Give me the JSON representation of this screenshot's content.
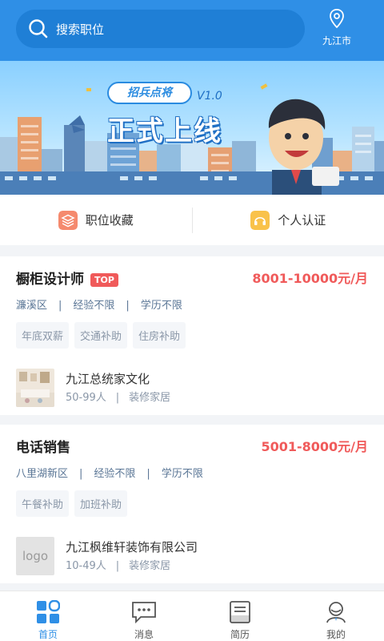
{
  "header": {
    "search_placeholder": "搜索职位",
    "city": "九江市"
  },
  "banner": {
    "badge": "招兵点将",
    "version": "V1.0",
    "headline": "正式上线"
  },
  "quick_links": [
    {
      "label": "职位收藏",
      "icon": "stack-icon",
      "color": "#f58a6e"
    },
    {
      "label": "个人认证",
      "icon": "headset-icon",
      "color": "#f9c24a"
    }
  ],
  "jobs": [
    {
      "title": "橱柜设计师",
      "badge": "TOP",
      "salary": "8001-10000元/月",
      "district": "濂溪区",
      "experience": "经验不限",
      "education": "学历不限",
      "tags": [
        "年底双薪",
        "交通补助",
        "住房补助"
      ],
      "company": "九江总统家文化",
      "size": "50-99人",
      "industry": "装修家居",
      "logo_text": ""
    },
    {
      "title": "电话销售",
      "badge": "",
      "salary": "5001-8000元/月",
      "district": "八里湖新区",
      "experience": "经验不限",
      "education": "学历不限",
      "tags": [
        "午餐补助",
        "加班补助"
      ],
      "company": "九江枫维轩装饰有限公司",
      "size": "10-49人",
      "industry": "装修家居",
      "logo_text": "logo"
    }
  ],
  "tabbar": [
    {
      "label": "首页",
      "icon": "home-grid-icon",
      "active": true
    },
    {
      "label": "消息",
      "icon": "message-icon",
      "active": false
    },
    {
      "label": "简历",
      "icon": "resume-icon",
      "active": false
    },
    {
      "label": "我的",
      "icon": "profile-icon",
      "active": false
    }
  ],
  "colors": {
    "primary": "#2f8fe6",
    "salary": "#f05a5a"
  }
}
